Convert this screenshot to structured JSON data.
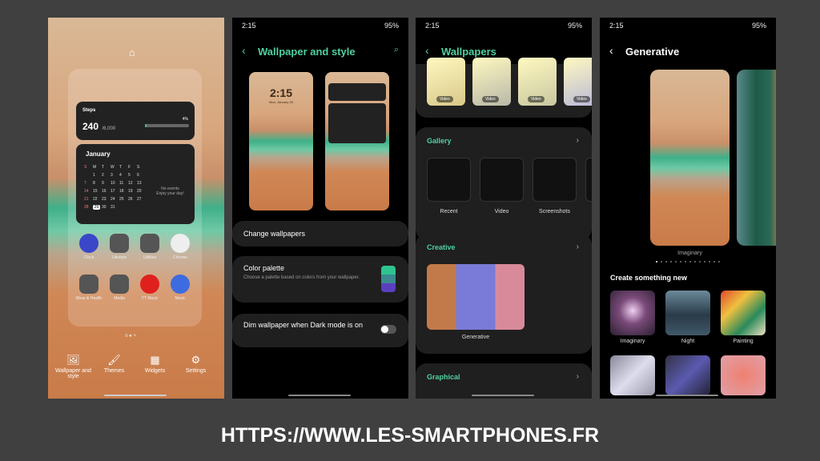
{
  "status": {
    "time": "2:15",
    "battery": "95%"
  },
  "home": {
    "steps": {
      "label": "Steps",
      "value": "240",
      "goal": "/6,000",
      "percent": "4%",
      "progress": 0.04
    },
    "calendar": {
      "month": "January",
      "weekdays": [
        "S",
        "M",
        "T",
        "W",
        "T",
        "F",
        "S"
      ],
      "days": [
        "",
        "1",
        "2",
        "3",
        "4",
        "5",
        "6",
        "7",
        "8",
        "9",
        "10",
        "11",
        "12",
        "13",
        "14",
        "15",
        "16",
        "17",
        "18",
        "19",
        "20",
        "21",
        "22",
        "23",
        "24",
        "25",
        "26",
        "27",
        "28",
        "29",
        "30",
        "31"
      ],
      "today": "29",
      "no_events": "No events",
      "enjoy": "Enjoy your day!"
    },
    "apps": [
      {
        "label": "Clock",
        "color": "#3a47c8"
      },
      {
        "label": "Lifestyle",
        "color": "#555"
      },
      {
        "label": "Utilities",
        "color": "#555"
      },
      {
        "label": "Chrome",
        "color": "#eee"
      },
      {
        "label": "Wear & Health",
        "color": "#555"
      },
      {
        "label": "Media",
        "color": "#555"
      },
      {
        "label": "YT Music",
        "color": "#e0201c"
      },
      {
        "label": "Music",
        "color": "#3d6be0"
      }
    ],
    "menu": [
      {
        "label": "Wallpaper and style",
        "icon": "image-icon"
      },
      {
        "label": "Themes",
        "icon": "brush-icon"
      },
      {
        "label": "Widgets",
        "icon": "widgets-icon"
      },
      {
        "label": "Settings",
        "icon": "gear-icon"
      }
    ]
  },
  "style": {
    "title": "Wallpaper and style",
    "lock_time": "2:15",
    "lock_date": "Mon, January 29",
    "change": "Change wallpapers",
    "palette_title": "Color palette",
    "palette_desc": "Choose a palette based on colors from your wallpaper.",
    "palette_colors": [
      "#2fc48f",
      "#3a8a8e",
      "#5a3fc0"
    ],
    "dim": "Dim wallpaper when Dark mode is on",
    "dim_on": false
  },
  "wallpapers": {
    "title": "Wallpapers",
    "video_badge": "Video",
    "gallery": {
      "title": "Gallery",
      "items": [
        "Recent",
        "Video",
        "Screenshots",
        "Sk"
      ]
    },
    "creative": {
      "title": "Creative",
      "item": "Generative"
    },
    "graphical": {
      "title": "Graphical"
    }
  },
  "generative": {
    "title": "Generative",
    "preview_label": "Imaginary",
    "page_count": 14,
    "current_page": 1,
    "create_title": "Create something new",
    "styles": [
      "Imaginary",
      "Night",
      "Painting"
    ]
  },
  "footer": "HTTPS://WWW.LES-SMARTPHONES.FR"
}
